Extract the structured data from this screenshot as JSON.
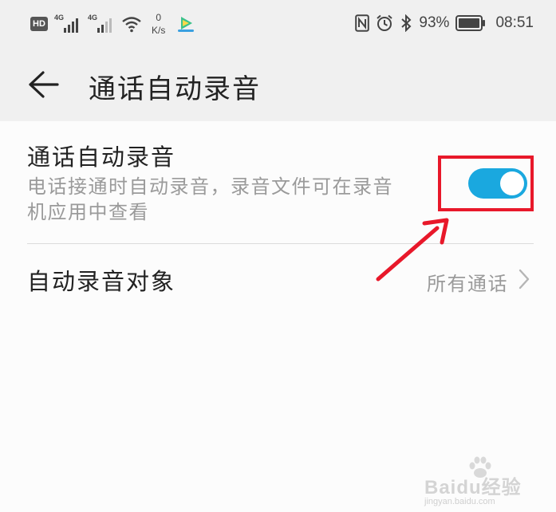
{
  "status_bar": {
    "hd_label": "HD",
    "sim1_network": "4G",
    "sim2_network": "4G",
    "net_speed_value": "0",
    "net_speed_unit": "K/s",
    "battery_percent": "93%",
    "time": "08:51",
    "icons": [
      "hd-icon",
      "signal-icon",
      "signal-icon",
      "wifi-icon",
      "app-icon",
      "nfc-icon",
      "alarm-icon",
      "bluetooth-icon",
      "battery-icon"
    ]
  },
  "app_bar": {
    "back_icon": "arrow-left-icon",
    "title": "通话自动录音"
  },
  "settings": {
    "auto_record": {
      "title": "通话自动录音",
      "description_line1": "电话接通时自动录音，录音文件可在录音",
      "description_line2": "机应用中查看",
      "enabled": true,
      "toggle_color": "#1aa8df"
    },
    "record_target": {
      "label": "自动录音对象",
      "value": "所有通话",
      "icon": "chevron-right-icon"
    }
  },
  "annotation": {
    "highlight_color": "#e8182a"
  },
  "watermark": {
    "brand": "Baidu经验",
    "url": "jingyan.baidu.com"
  }
}
